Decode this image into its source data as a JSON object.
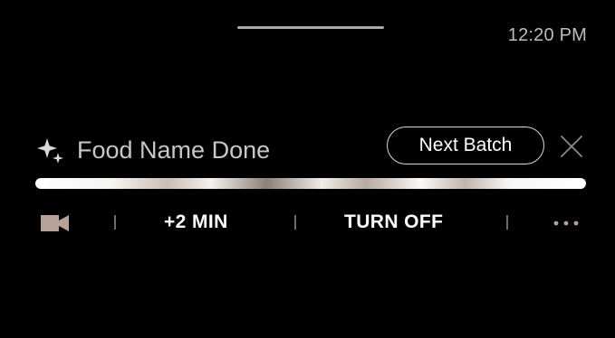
{
  "status_bar": {
    "time": "12:20 PM"
  },
  "cooking": {
    "title": "Food Name Done",
    "next_batch_label": "Next Batch",
    "progress": 1.0
  },
  "controls": {
    "add_time_label": "+2 MIN",
    "turn_off_label": "TURN OFF"
  },
  "icons": {
    "sparkle": "sparkle-icon",
    "close": "close-icon",
    "camera": "video-camera-icon",
    "more": "more-horizontal-icon"
  },
  "colors": {
    "background": "#000000",
    "accent_icon": "#b5a397",
    "title_text": "#c9c6c3"
  }
}
